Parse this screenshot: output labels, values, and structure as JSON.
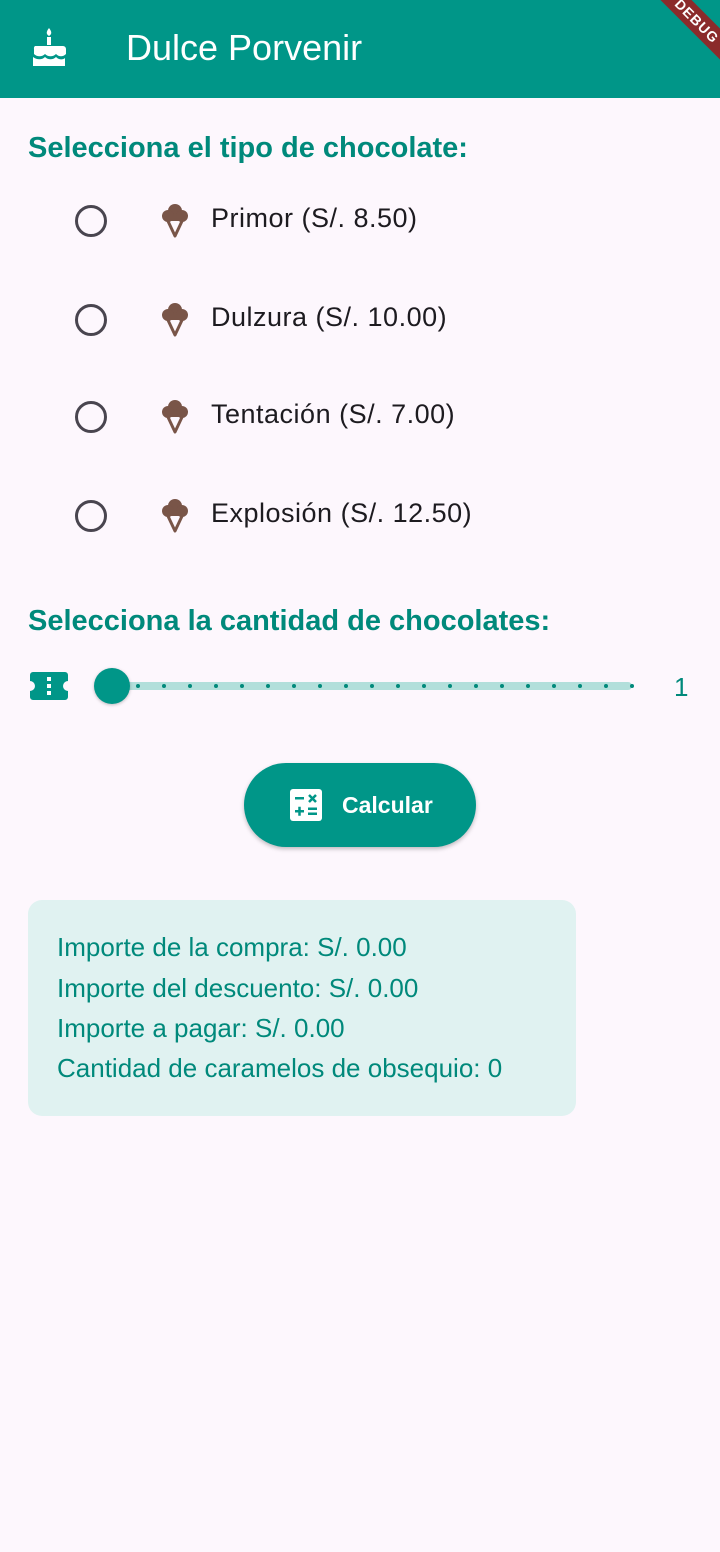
{
  "app": {
    "title": "Dulce Porvenir",
    "logo_icon": "cake-icon",
    "debug_banner": "DEBUG",
    "colors": {
      "primary": "#009688",
      "primary_text": "#00897b",
      "background": "#fdf7fd",
      "card": "#e0f2f1",
      "icon_brown": "#795548"
    }
  },
  "chocolate_section": {
    "title": "Selecciona el tipo de chocolate:",
    "options": [
      {
        "label": "Primor (S/. 8.50)",
        "icon": "ice-cream-icon",
        "selected": false
      },
      {
        "label": "Dulzura (S/. 10.00)",
        "icon": "ice-cream-icon",
        "selected": false
      },
      {
        "label": "Tentación (S/. 7.00)",
        "icon": "ice-cream-icon",
        "selected": false
      },
      {
        "label": "Explosión (S/. 12.50)",
        "icon": "ice-cream-icon",
        "selected": false
      }
    ]
  },
  "quantity_section": {
    "title": "Selecciona la cantidad de chocolates:",
    "icon": "ticket-icon",
    "slider": {
      "min": 1,
      "max": 21,
      "divisions": 20,
      "value": 1
    },
    "value_label": "1"
  },
  "calculate_button": {
    "label": "Calcular",
    "icon": "calculate-icon"
  },
  "results": {
    "purchase": "Importe de la compra: S/. 0.00",
    "discount": "Importe del descuento: S/. 0.00",
    "to_pay": "Importe a pagar: S/. 0.00",
    "candies": "Cantidad de caramelos de obsequio: 0"
  }
}
